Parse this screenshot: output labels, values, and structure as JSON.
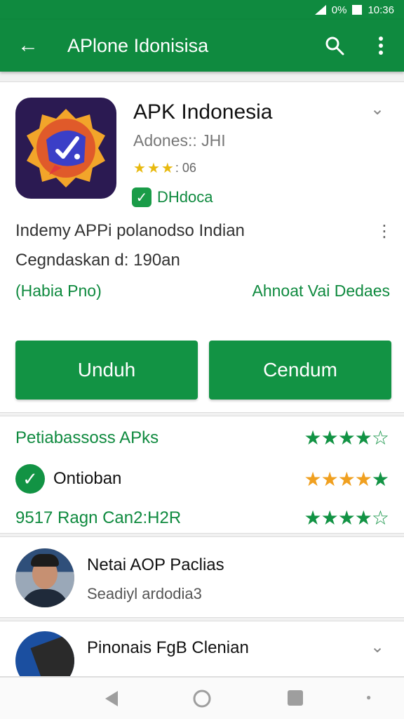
{
  "status_bar": {
    "battery": "0%",
    "time": "10:36"
  },
  "app_bar": {
    "back_icon": "arrow-left-icon",
    "title": "APlone Idonisisa",
    "search_icon": "search-icon",
    "more_icon": "more-vert-icon"
  },
  "app": {
    "name": "APK Indonesia",
    "developer": "Adones:: JHI",
    "rating_text": ": 06",
    "badge": "DHdoca",
    "description_line1": "Indemy APPi polanodso Indian",
    "description_line2": "Cegndaskan d: 190an",
    "link_left": "(Habia Pno)",
    "link_right": "Ahnoat Vai Dedaes",
    "install_button": "Unduh",
    "second_button": "Cendum",
    "colors": {
      "primary": "#0f8a3f",
      "star": "#e8b90e"
    }
  },
  "ratings": {
    "rows": [
      {
        "label": "Petiabassoss APks",
        "filled": 4,
        "total": 5
      },
      {
        "label": "Ontioban",
        "filled": 5,
        "total": 5
      },
      {
        "label": "9517 Ragn Can2:H2R",
        "filled": 4,
        "total": 5
      }
    ]
  },
  "developer_cards": [
    {
      "name": "Netai AOP Paclias",
      "subtitle": "Seadiyl ardodia3"
    },
    {
      "name": "Pinonais FgB Clenian"
    }
  ],
  "nav": {
    "back_icon": "back-triangle-icon",
    "home_icon": "home-circle-icon",
    "recent_icon": "recent-square-icon"
  }
}
